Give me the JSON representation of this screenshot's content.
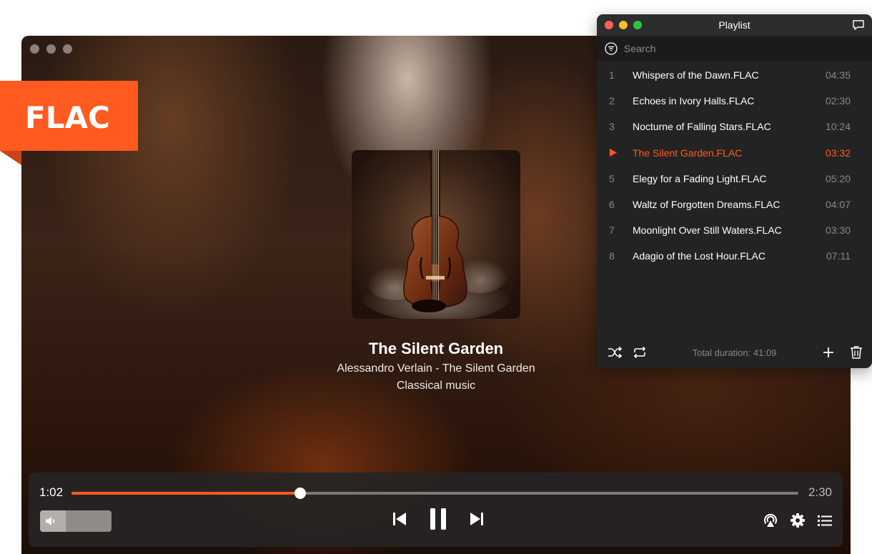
{
  "badge": {
    "label": "FLAC"
  },
  "player": {
    "now_playing": {
      "title": "The Silent Garden",
      "artist_line": "Alessandro Verlain - The Silent Garden",
      "genre": "Classical music"
    },
    "seek": {
      "current": "1:02",
      "total": "2:30",
      "progress": 0.315
    },
    "volume": {
      "level": 0.36
    },
    "icons": {
      "volume": "speaker-icon",
      "previous": "skip-previous-icon",
      "pause": "pause-icon",
      "next": "skip-next-icon",
      "airplay": "airplay-icon",
      "settings": "gear-icon",
      "playlist": "list-icon"
    }
  },
  "playlist_window": {
    "title": "Playlist",
    "search": {
      "placeholder": "Search",
      "value": ""
    },
    "items": [
      {
        "num": "1",
        "name": "Whispers of the Dawn.FLAC",
        "duration": "04:35",
        "active": false
      },
      {
        "num": "2",
        "name": "Echoes in Ivory Halls.FLAC",
        "duration": "02:30",
        "active": false
      },
      {
        "num": "3",
        "name": "Nocturne of Falling Stars.FLAC",
        "duration": "10:24",
        "active": false
      },
      {
        "num": "",
        "name": "The Silent Garden.FLAC",
        "duration": "03:32",
        "active": true
      },
      {
        "num": "5",
        "name": "Elegy for a Fading Light.FLAC",
        "duration": "05:20",
        "active": false
      },
      {
        "num": "6",
        "name": "Waltz of Forgotten Dreams.FLAC",
        "duration": "04:07",
        "active": false
      },
      {
        "num": "7",
        "name": "Moonlight Over Still Waters.FLAC",
        "duration": "03:30",
        "active": false
      },
      {
        "num": "8",
        "name": "Adagio of the Lost Hour.FLAC",
        "duration": "07:11",
        "active": false
      }
    ],
    "total_duration": "Total duration: 41:09",
    "icons": {
      "shuffle": "shuffle-icon",
      "repeat": "repeat-icon",
      "add": "plus-icon",
      "delete": "trash-icon",
      "chat": "chat-bubble-icon",
      "search": "filter-icon"
    }
  },
  "colors": {
    "accent": "#ff5a1f",
    "panel": "#242323",
    "controls_bg": "#262424",
    "text_muted": "#8a8784"
  }
}
